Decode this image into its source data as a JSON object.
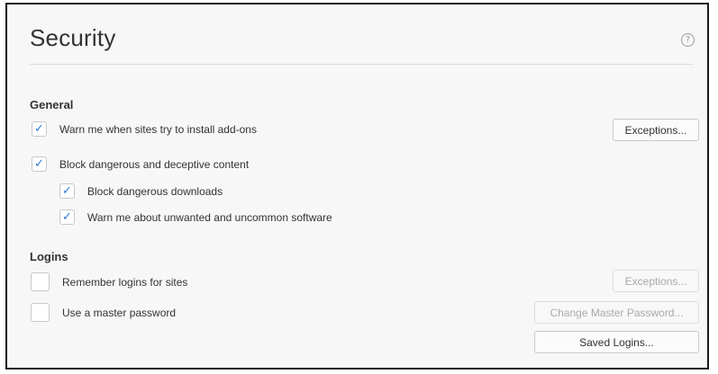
{
  "header": {
    "title": "Security",
    "help_icon": "help-icon",
    "help_glyph": "?"
  },
  "general": {
    "heading": "General",
    "warn_addons": {
      "label": "Warn me when sites try to install add-ons",
      "checked": true,
      "exceptions_label": "Exceptions..."
    },
    "block_dangerous": {
      "label": "Block dangerous and deceptive content",
      "checked": true
    },
    "block_downloads": {
      "label": "Block dangerous downloads",
      "checked": true
    },
    "warn_unwanted": {
      "label": "Warn me about unwanted and uncommon software",
      "checked": true
    }
  },
  "logins": {
    "heading": "Logins",
    "remember_logins": {
      "label": "Remember logins for sites",
      "checked": false,
      "exceptions_label": "Exceptions...",
      "exceptions_disabled": true
    },
    "master_password": {
      "label": "Use a master password",
      "checked": false,
      "change_label": "Change Master Password...",
      "change_disabled": true
    },
    "saved_logins_label": "Saved Logins..."
  },
  "icons": {
    "check": "checkmark-icon"
  },
  "colors": {
    "accent": "#2a7ad6",
    "background": "#f7f7f7",
    "text": "#333333",
    "disabled_text": "#aaaaaa"
  }
}
